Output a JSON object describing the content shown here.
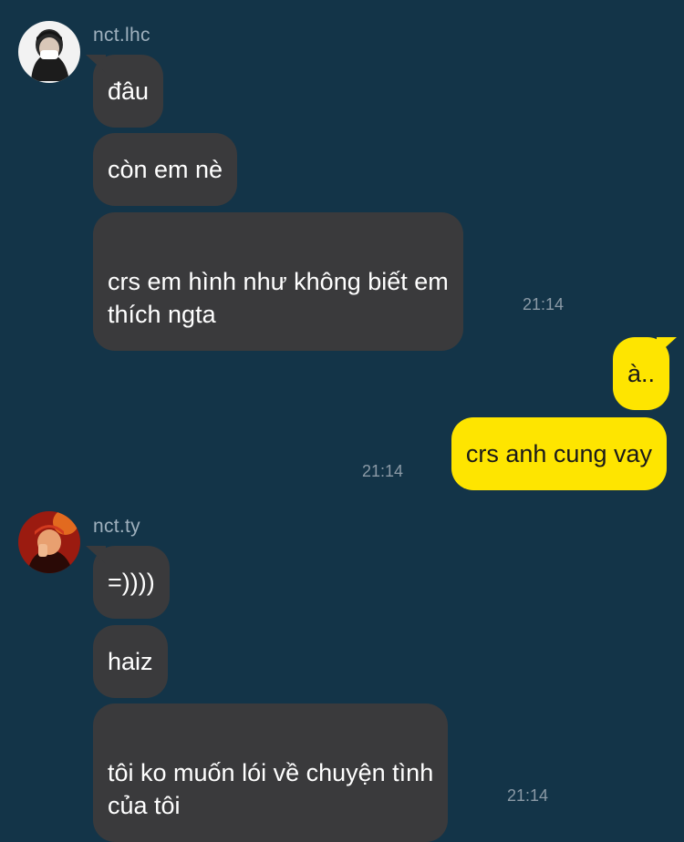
{
  "colors": {
    "background": "#133448",
    "incoming_bubble": "#3a3a3c",
    "outgoing_bubble": "#fee500",
    "sender_text": "#9fb0bd",
    "timestamp_text": "#8b9aa6"
  },
  "chat": {
    "group1": {
      "sender": "nct.lhc",
      "avatar_icon": "user-photo-icon",
      "messages": [
        "đâu",
        "còn em nè",
        "crs em hình như không biết em\nthích ngta"
      ],
      "time": "21:14"
    },
    "mine": {
      "messages": [
        "à..",
        "crs anh cung vay"
      ],
      "time": "21:14"
    },
    "group2": {
      "sender": "nct.ty",
      "avatar_icon": "user-photo-icon",
      "messages": [
        "=))))",
        "haiz",
        "tôi ko muốn lói về chuyện tình\ncủa tôi"
      ],
      "time": "21:14"
    }
  }
}
